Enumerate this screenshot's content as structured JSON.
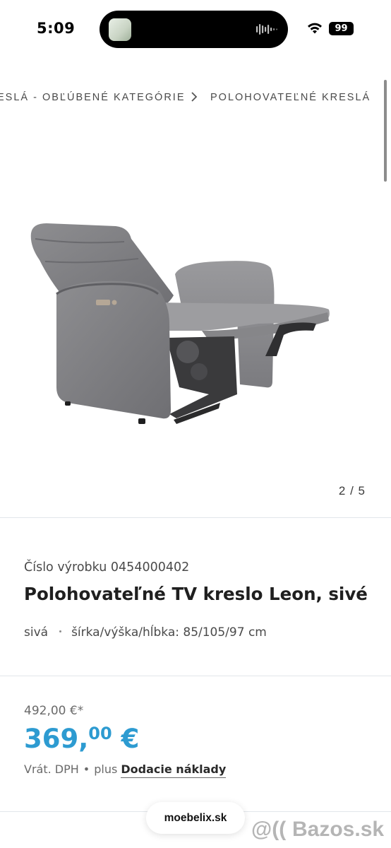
{
  "status_bar": {
    "time": "5:09",
    "battery": "99"
  },
  "breadcrumb": {
    "items": [
      "ESLÁ - OBĽÚBENÉ KATEGÓRIE",
      "POLOHOVATEĽNÉ KRESLÁ"
    ]
  },
  "gallery": {
    "counter": "2 / 5",
    "current_index": 2,
    "total": 5,
    "image_icon": "recliner-chair-image"
  },
  "product": {
    "number_label": "Číslo výrobku 0454000402",
    "title_bold": "Polohovateľné",
    "title_rest": " TV kreslo Leon, sivé",
    "color": "sivá",
    "dimensions": "šírka/výška/hĺbka: 85/105/97 cm"
  },
  "price": {
    "old": "492,00 €*",
    "new_main": "369,",
    "new_cents": "00",
    "currency": " €",
    "tax_label": "Vrát. DPH",
    "separator": "•",
    "plus_label": "plus",
    "shipping_link": "Dodacie náklady"
  },
  "browser": {
    "url": "moebelix.sk"
  },
  "watermark": {
    "text": "Bazos.sk"
  },
  "colors": {
    "price_accent": "#2d9bd1",
    "text": "#1f1f1f",
    "muted": "#4a4a4a",
    "divider": "#e2e6ea"
  }
}
